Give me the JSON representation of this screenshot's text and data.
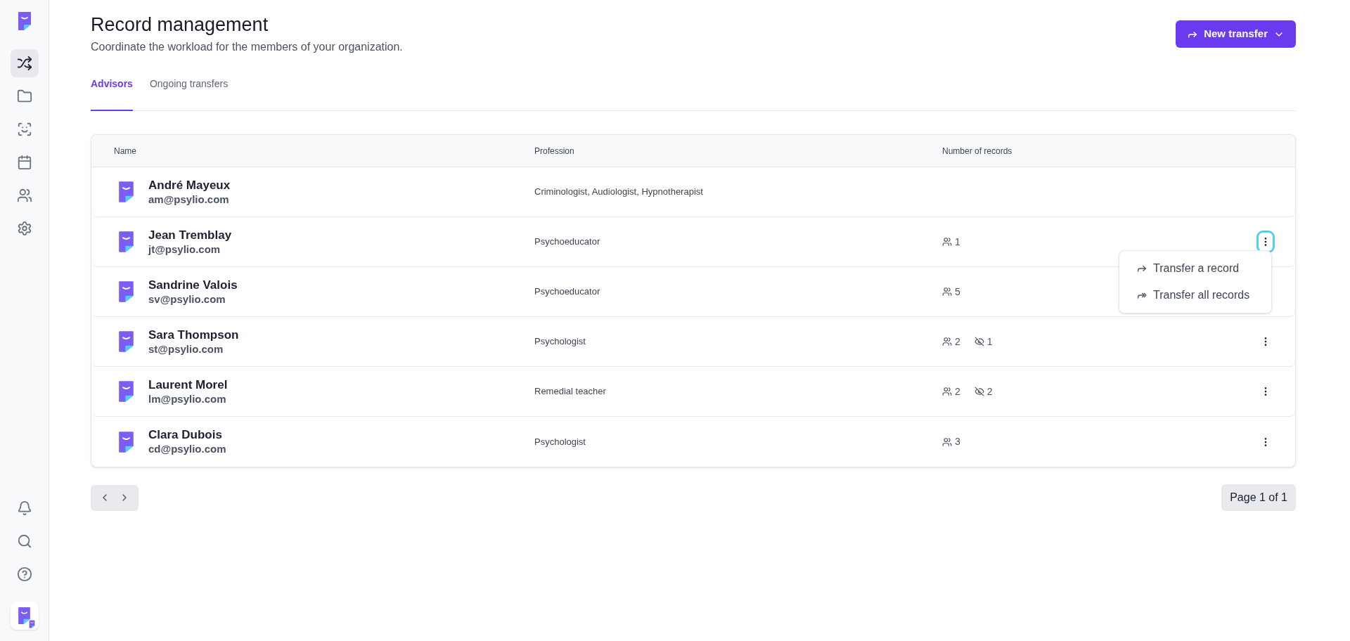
{
  "sidebar": {
    "items": [
      {
        "selected": true
      },
      {
        "selected": false
      },
      {
        "selected": false
      },
      {
        "selected": false
      },
      {
        "selected": false
      },
      {
        "selected": false
      }
    ]
  },
  "header": {
    "title": "Record management",
    "subtitle": "Coordinate the workload for the members of your organization.",
    "action": "New transfer"
  },
  "tabs": [
    {
      "label": "Advisors",
      "selected": true
    },
    {
      "label": "Ongoing transfers",
      "selected": false
    }
  ],
  "table": {
    "columns": [
      "Name",
      "Profession",
      "Number of records"
    ],
    "rows": [
      {
        "name": "André Mayeux",
        "email": "am@psylio.com",
        "profession": "Criminologist, Audiologist, Hypnotherapist",
        "menu_button": false,
        "menu_open": false
      },
      {
        "name": "Jean Tremblay",
        "email": "jt@psylio.com",
        "profession": "Psychoeducator",
        "clients": "1",
        "menu_button": true,
        "menu_open": true
      },
      {
        "name": "Sandrine Valois",
        "email": "sv@psylio.com",
        "profession": "Psychoeducator",
        "clients": "5",
        "menu_button": false,
        "menu_open": false
      },
      {
        "name": "Sara Thompson",
        "email": "st@psylio.com",
        "profession": "Psychologist",
        "clients": "2",
        "hidden": "1",
        "menu_button": true,
        "menu_open": false
      },
      {
        "name": "Laurent Morel",
        "email": "lm@psylio.com",
        "profession": "Remedial teacher",
        "clients": "2",
        "hidden": "2",
        "menu_button": true,
        "menu_open": false
      },
      {
        "name": "Clara Dubois",
        "email": "cd@psylio.com",
        "profession": "Psychologist",
        "clients": "3",
        "menu_button": true,
        "menu_open": false
      }
    ]
  },
  "row_menu": {
    "items": [
      {
        "label": "Transfer a record",
        "kind": "single"
      },
      {
        "label": "Transfer all records",
        "kind": "all"
      }
    ]
  },
  "pagination": {
    "label": "Page 1 of 1"
  }
}
